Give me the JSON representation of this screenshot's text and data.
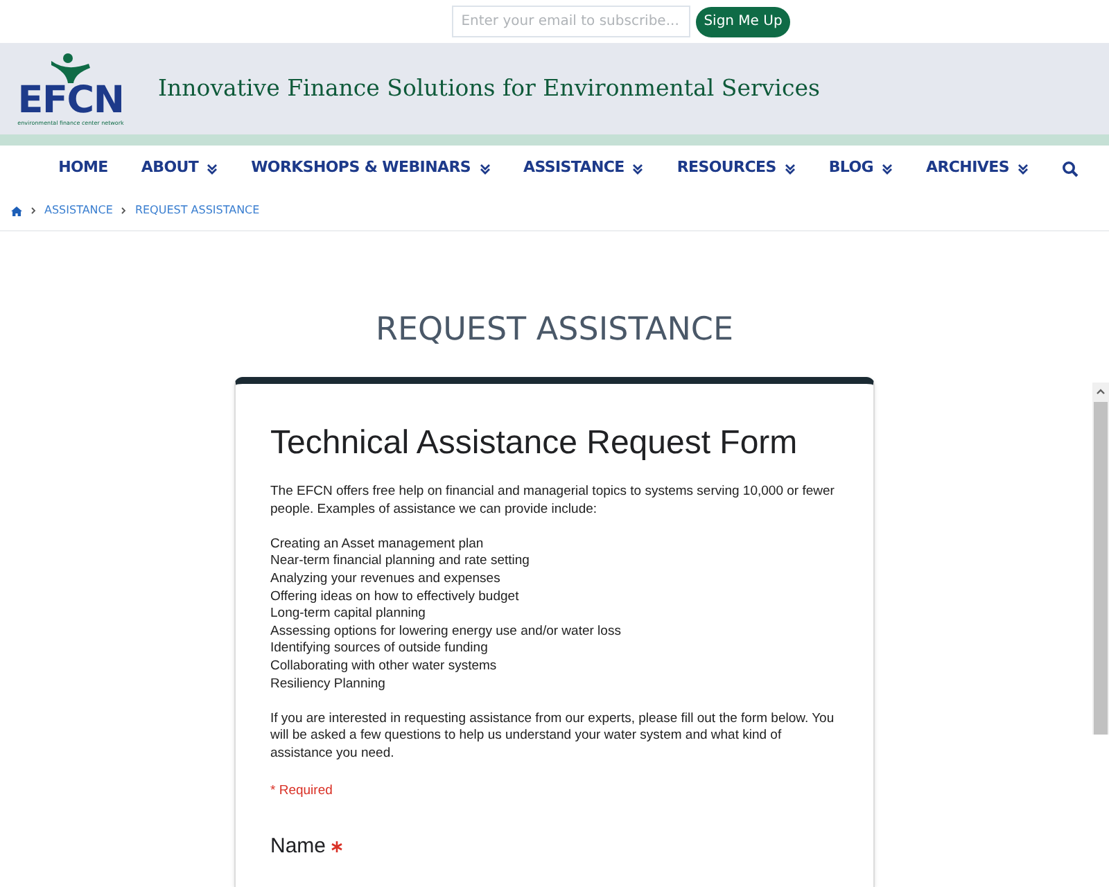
{
  "subscribe": {
    "placeholder": "Enter your email to subscribe...",
    "button": "Sign Me Up"
  },
  "header": {
    "logo_letters": "EFCN",
    "logo_caption": "environmental finance center network",
    "tagline": "Innovative Finance Solutions for Environmental Services"
  },
  "nav": {
    "items": [
      {
        "label": "HOME",
        "dropdown": false
      },
      {
        "label": "ABOUT",
        "dropdown": true
      },
      {
        "label": "WORKSHOPS & WEBINARS",
        "dropdown": true
      },
      {
        "label": "ASSISTANCE",
        "dropdown": true
      },
      {
        "label": "RESOURCES",
        "dropdown": true
      },
      {
        "label": "BLOG",
        "dropdown": true
      },
      {
        "label": "ARCHIVES",
        "dropdown": true
      }
    ]
  },
  "breadcrumb": [
    "ASSISTANCE",
    "REQUEST ASSISTANCE"
  ],
  "page_title": "REQUEST ASSISTANCE",
  "form": {
    "title": "Technical Assistance Request Form",
    "intro": "The EFCN offers free help on financial and managerial topics to systems serving 10,000 or fewer people. Examples of assistance we can provide include:",
    "list": [
      "Creating an Asset management plan",
      "Near-term financial planning and rate setting",
      "Analyzing your revenues and expenses",
      "Offering ideas on how to effectively budget",
      "Long-term capital planning",
      "Assessing options for lowering energy use and/or water loss",
      "Identifying sources of outside funding",
      "Collaborating with other water systems",
      "Resiliency Planning"
    ],
    "outro": "If you are interested in requesting assistance from our experts, please fill out the form below. You will be asked a few questions to help us understand your water system and what kind of assistance you need.",
    "required_note": "* Required",
    "questions": [
      {
        "label": "Name",
        "required": true
      }
    ]
  }
}
